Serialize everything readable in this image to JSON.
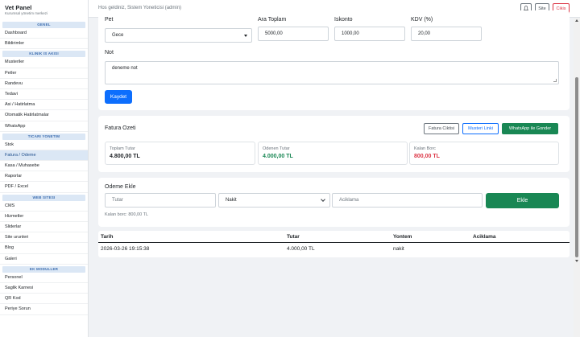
{
  "brand": {
    "title": "Vet Panel",
    "subtitle": "Kurumsal yönetim merkezi"
  },
  "sidebar": {
    "groups": [
      {
        "title": "GENEL",
        "items": [
          "Dashboard",
          "Bildirimler"
        ]
      },
      {
        "title": "KLINIK IS AKISI",
        "items": [
          "Musteriler",
          "Petler",
          "Randevu",
          "Tedavi",
          "Asi / Hatirlatma",
          "Otomatik Hatirlatmalar",
          "WhatsApp"
        ]
      },
      {
        "title": "TICARI YONETIM",
        "items": [
          "Stok",
          "Fatura / Odeme",
          "Kasa / Muhasebe",
          "Raporlar",
          "PDF / Excel"
        ]
      },
      {
        "title": "WEB SITESI",
        "items": [
          "CMS",
          "Hizmetler",
          "Sliderlar",
          "Site urunleri",
          "Blog",
          "Galeri"
        ]
      },
      {
        "title": "EK MODULLER",
        "items": [
          "Personel",
          "Saglik Karnesi",
          "QR Kod",
          "Periye Sorun"
        ]
      }
    ],
    "active_item": "Fatura / Odeme"
  },
  "topbar": {
    "greeting": "Hos geldiniz, Sistem Yoneticisi (admin)",
    "bell_icon": "bell-icon",
    "site_label": "Site",
    "exit_label": "Cikis"
  },
  "invoice_form": {
    "pet_label": "Pet",
    "pet_value": "Gece",
    "subtotal_label": "Ara Toplam",
    "subtotal_value": "5000,00",
    "discount_label": "Iskonto",
    "discount_value": "1000,00",
    "vat_label": "KDV (%)",
    "vat_value": "20,00",
    "note_label": "Not",
    "note_value": "deneme not",
    "save_label": "Kaydet"
  },
  "summary": {
    "title": "Fatura Ozeti",
    "print_label": "Fatura Ciktisi",
    "customer_link_label": "Musteri Linki",
    "whatsapp_label": "WhatsApp ile Gonder",
    "total_label": "Toplam Tutar",
    "total_value": "4.800,00 TL",
    "paid_label": "Odenen Tutar",
    "paid_value": "4.000,00 TL",
    "due_label": "Kalan Borc",
    "due_value": "800,00 TL",
    "colors": {
      "paid": "#198754",
      "due": "#dc3545"
    }
  },
  "payment": {
    "title": "Odeme Ekle",
    "amount_placeholder": "Tutar",
    "method_value": "Nakit",
    "description_placeholder": "Aciklama",
    "add_label": "Ekle",
    "remaining_text": "Kalan borc: 800,00 TL"
  },
  "payments_table": {
    "headers": [
      "Tarih",
      "Tutar",
      "Yontem",
      "Aciklama"
    ],
    "rows": [
      [
        "2026-03-26 19:15:38",
        "4.000,00 TL",
        "nakit",
        ""
      ]
    ]
  }
}
